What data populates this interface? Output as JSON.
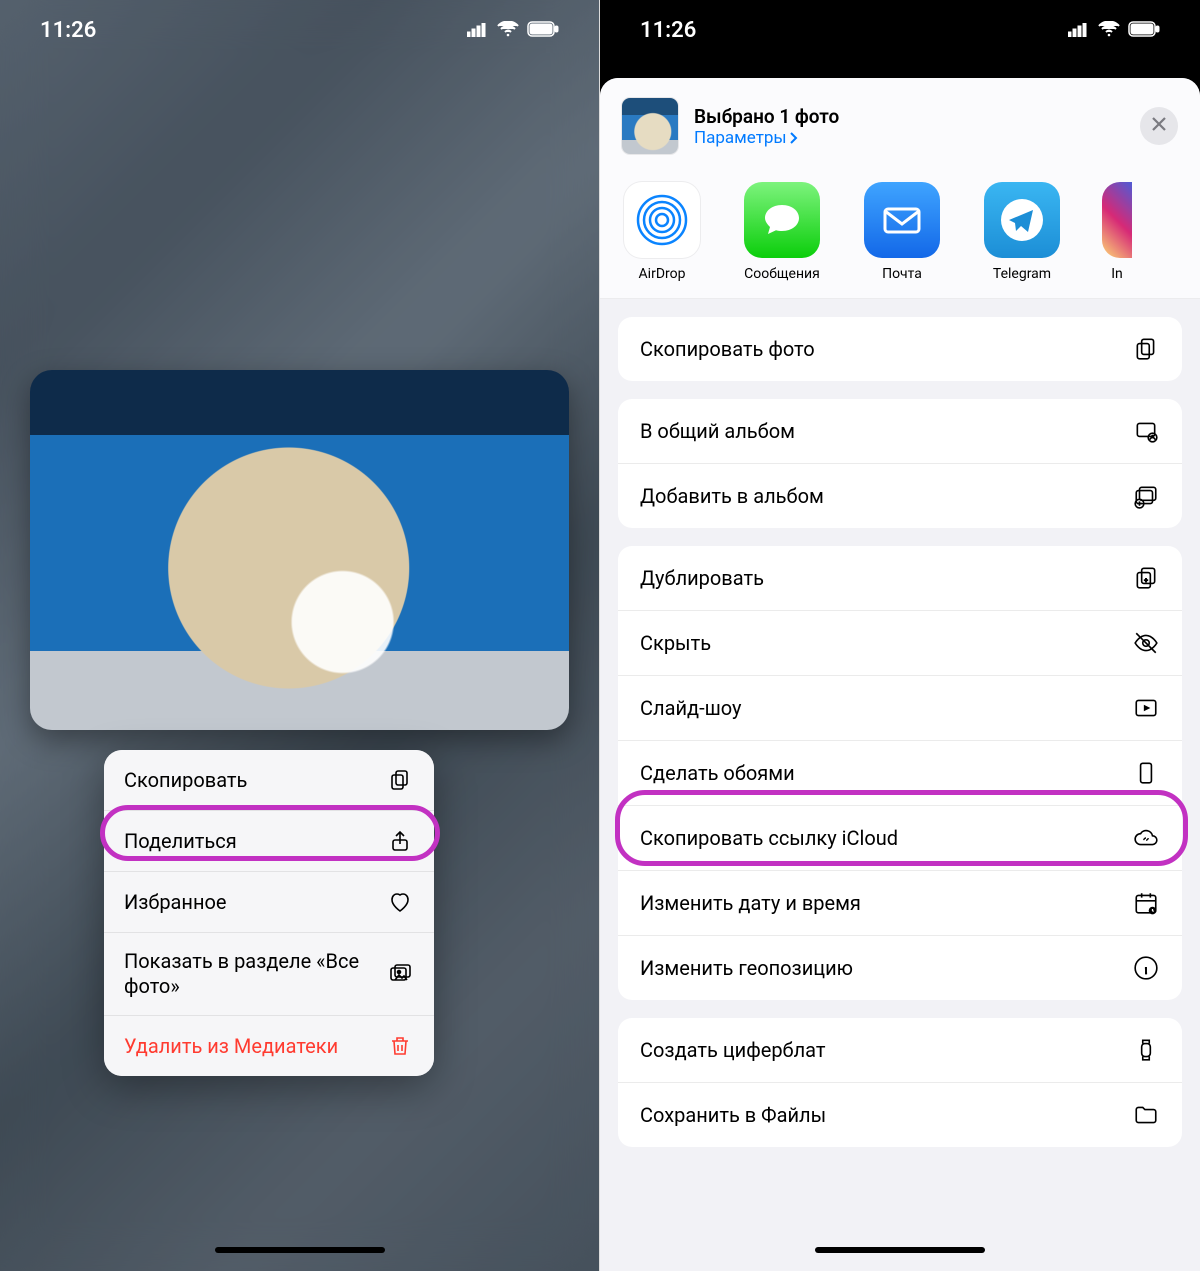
{
  "status": {
    "time": "11:26"
  },
  "left": {
    "menu": {
      "copy": "Скопировать",
      "share": "Поделиться",
      "favorite": "Избранное",
      "show_all": "Показать в разделе «Все фото»",
      "delete": "Удалить из Медиатеки"
    }
  },
  "right": {
    "header": {
      "title": "Выбрано 1 фото",
      "options": "Параметры"
    },
    "apps": {
      "airdrop": "AirDrop",
      "messages": "Сообщения",
      "mail": "Почта",
      "telegram": "Telegram",
      "instagram": "In"
    },
    "actions": {
      "copy_photo": "Скопировать фото",
      "shared_album": "В общий альбом",
      "add_album": "Добавить в альбом",
      "duplicate": "Дублировать",
      "hide": "Скрыть",
      "slideshow": "Слайд-шоу",
      "wallpaper": "Сделать обоями",
      "icloud_link": "Скопировать ссылку iCloud",
      "edit_date": "Изменить дату и время",
      "edit_location": "Изменить геопозицию",
      "watch_face": "Создать циферблат",
      "save_files": "Сохранить в Файлы"
    }
  }
}
